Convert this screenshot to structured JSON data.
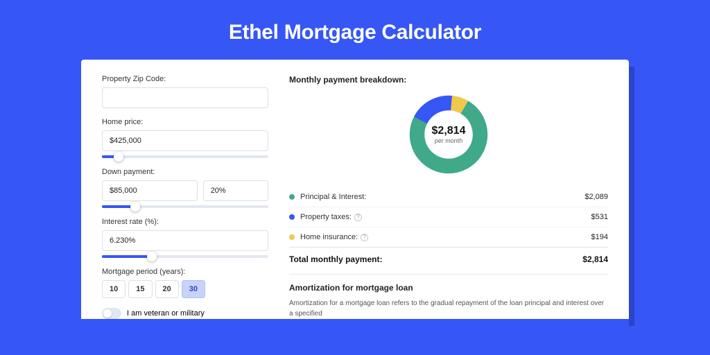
{
  "title": "Ethel Mortgage Calculator",
  "left": {
    "zip_label": "Property Zip Code:",
    "zip_value": "",
    "home_price_label": "Home price:",
    "home_price_value": "$425,000",
    "home_price_slider_pct": 10,
    "down_payment_label": "Down payment:",
    "down_payment_value": "$85,000",
    "down_payment_pct": "20%",
    "down_payment_slider_pct": 20,
    "interest_label": "Interest rate (%):",
    "interest_value": "6.230%",
    "interest_slider_pct": 30,
    "period_label": "Mortgage period (years):",
    "period_options": [
      "10",
      "15",
      "20",
      "30"
    ],
    "period_selected": "30",
    "veteran_label": "I am veteran or military"
  },
  "right": {
    "breakdown_title": "Monthly payment breakdown:",
    "center_value": "$2,814",
    "center_sub": "per month",
    "items": [
      {
        "label": "Principal & Interest:",
        "value": "$2,089",
        "color": "#3fa98a",
        "help": false
      },
      {
        "label": "Property taxes:",
        "value": "$531",
        "color": "#3656f5",
        "help": true
      },
      {
        "label": "Home insurance:",
        "value": "$194",
        "color": "#f0c84b",
        "help": true
      }
    ],
    "total_label": "Total monthly payment:",
    "total_value": "$2,814",
    "amort_title": "Amortization for mortgage loan",
    "amort_text": "Amortization for a mortgage loan refers to the gradual repayment of the loan principal and interest over a specified"
  },
  "chart_data": {
    "type": "pie",
    "title": "Monthly payment breakdown",
    "total": 2814,
    "series": [
      {
        "name": "Principal & Interest",
        "value": 2089,
        "color": "#3fa98a"
      },
      {
        "name": "Property taxes",
        "value": 531,
        "color": "#3656f5"
      },
      {
        "name": "Home insurance",
        "value": 194,
        "color": "#f0c84b"
      }
    ]
  }
}
